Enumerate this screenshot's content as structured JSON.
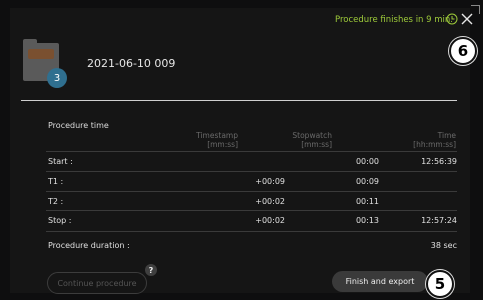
{
  "status": {
    "message": "Procedure finishes in 9 min.",
    "color": "#9ecb3a",
    "clock_icon": "clock-icon",
    "close_icon": "close-icon"
  },
  "callouts": {
    "six": "6",
    "five": "5"
  },
  "recording": {
    "title": "2021-06-10 009",
    "count": "3",
    "thumbnail_icon": "folder-thumbnail-icon"
  },
  "table": {
    "title": "Procedure time",
    "headers": {
      "timestamp": "Timestamp",
      "timestamp_unit": "[mm:ss]",
      "stopwatch": "Stopwatch",
      "stopwatch_unit": "[mm:ss]",
      "time": "Time",
      "time_unit": "[hh:mm:ss]"
    },
    "rows": [
      {
        "label": "Start :",
        "timestamp": "",
        "stopwatch": "00:00",
        "time": "12:56:39"
      },
      {
        "label": "T1 :",
        "timestamp": "+00:09",
        "stopwatch": "00:09",
        "time": ""
      },
      {
        "label": "T2 :",
        "timestamp": "+00:02",
        "stopwatch": "00:11",
        "time": ""
      },
      {
        "label": "Stop :",
        "timestamp": "+00:02",
        "stopwatch": "00:13",
        "time": "12:57:24"
      }
    ],
    "duration_label": "Procedure duration :",
    "duration_value": "38 sec"
  },
  "buttons": {
    "continue": "Continue procedure",
    "help": "?",
    "finish": "Finish and export"
  }
}
